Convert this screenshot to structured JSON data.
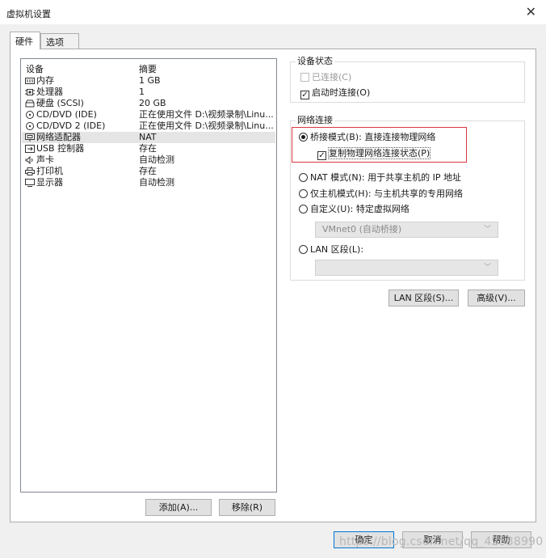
{
  "window": {
    "title": "虚拟机设置",
    "close_glyph": "✕"
  },
  "tabs": [
    {
      "label": "硬件",
      "active": true
    },
    {
      "label": "选项",
      "active": false
    }
  ],
  "device_table": {
    "headers": {
      "device": "设备",
      "summary": "摘要"
    },
    "rows": [
      {
        "name": "内存",
        "summary": "1 GB",
        "icon": "memory-icon"
      },
      {
        "name": "处理器",
        "summary": "1",
        "icon": "processor-icon"
      },
      {
        "name": "硬盘 (SCSI)",
        "summary": "20 GB",
        "icon": "hard-disk-icon"
      },
      {
        "name": "CD/DVD (IDE)",
        "summary": "正在使用文件 D:\\视频录制\\Linu...",
        "icon": "cd-dvd-icon"
      },
      {
        "name": "CD/DVD 2 (IDE)",
        "summary": "正在使用文件 D:\\视频录制\\Linu...",
        "icon": "cd-dvd-icon"
      },
      {
        "name": "网络适配器",
        "summary": "NAT",
        "icon": "network-adapter-icon",
        "selected": true
      },
      {
        "name": "USB 控制器",
        "summary": "存在",
        "icon": "usb-icon"
      },
      {
        "name": "声卡",
        "summary": "自动检测",
        "icon": "sound-card-icon"
      },
      {
        "name": "打印机",
        "summary": "存在",
        "icon": "printer-icon"
      },
      {
        "name": "显示器",
        "summary": "自动检测",
        "icon": "display-icon"
      }
    ]
  },
  "list_buttons": {
    "add": "添加(A)...",
    "remove": "移除(R)"
  },
  "device_status": {
    "label": "设备状态",
    "connected": {
      "label": "已连接(C)",
      "checked": false,
      "disabled": true
    },
    "connect_on_power": {
      "label": "启动时连接(O)",
      "checked": true
    }
  },
  "network": {
    "label": "网络连接",
    "bridged": {
      "label": "桥接模式(B): 直接连接物理网络",
      "selected": true
    },
    "replicate": {
      "label": "复制物理网络连接状态(P)",
      "checked": true
    },
    "nat": {
      "label": "NAT 模式(N): 用于共享主机的 IP 地址",
      "selected": false
    },
    "host_only": {
      "label": "仅主机模式(H): 与主机共享的专用网络",
      "selected": false
    },
    "custom": {
      "label": "自定义(U): 特定虚拟网络",
      "selected": false
    },
    "custom_combo_value": "VMnet0 (自动桥接)",
    "lan_segment": {
      "label": "LAN 区段(L):",
      "selected": false
    },
    "lan_combo_value": ""
  },
  "net_buttons": {
    "lan_segments": "LAN 区段(S)...",
    "advanced": "高级(V)..."
  },
  "footer": {
    "ok": "确定",
    "cancel": "取消",
    "help": "帮助"
  },
  "watermark": "https://blog.csdn.net/qq_42538990"
}
